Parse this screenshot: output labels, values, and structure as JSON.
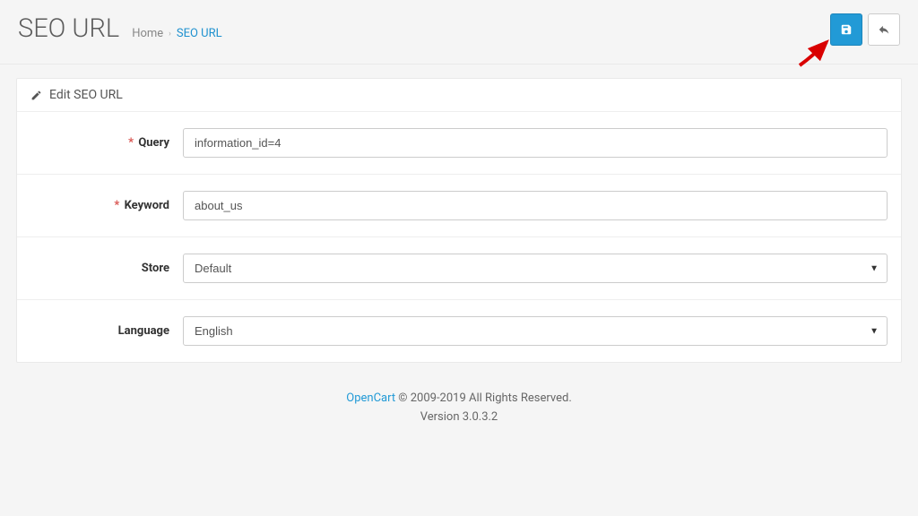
{
  "header": {
    "title": "SEO URL",
    "breadcrumb_home": "Home",
    "breadcrumb_current": "SEO URL"
  },
  "panel": {
    "heading": "Edit SEO URL"
  },
  "form": {
    "query": {
      "label": "Query",
      "value": "information_id=4",
      "required": true
    },
    "keyword": {
      "label": "Keyword",
      "value": "about_us",
      "required": true
    },
    "store": {
      "label": "Store",
      "selected": "Default",
      "required": false
    },
    "language": {
      "label": "Language",
      "selected": "English",
      "required": false
    }
  },
  "footer": {
    "link_text": "OpenCart",
    "copyright": " © 2009-2019 All Rights Reserved.",
    "version": "Version 3.0.3.2"
  }
}
